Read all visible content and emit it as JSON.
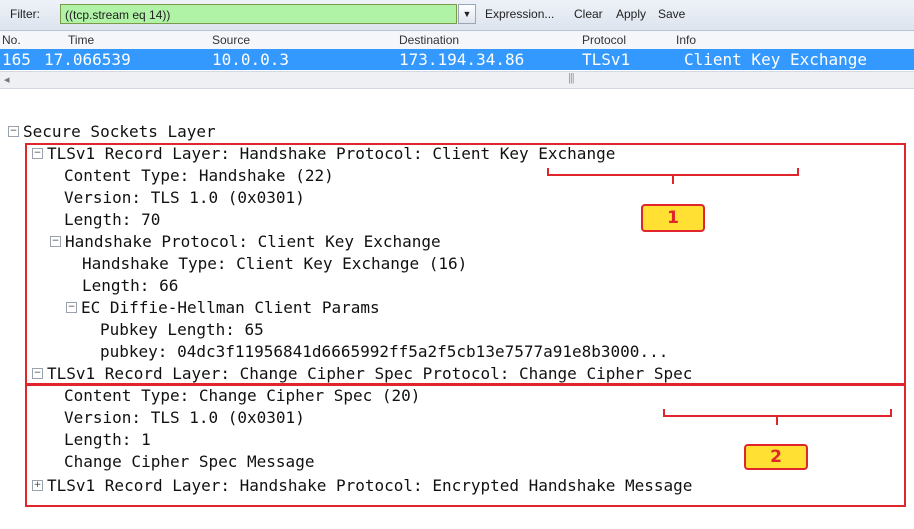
{
  "toolbar": {
    "filter_label": "Filter:",
    "filter_value": "((tcp.stream eq 14))",
    "expression": "Expression...",
    "clear": "Clear",
    "apply": "Apply",
    "save": "Save",
    "filter_color": "#b0f2a6"
  },
  "packet_list": {
    "columns": [
      "No.",
      "Time",
      "Source",
      "Destination",
      "Protocol",
      "Info"
    ],
    "selected_row": {
      "no": "165",
      "time": "17.066539",
      "source": "10.0.0.3",
      "destination": "173.194.34.86",
      "protocol": "TLSv1",
      "info": "Client Key Exchange"
    },
    "selection_color": "#3399ff"
  },
  "tree": {
    "ssl": "Secure Sockets Layer",
    "rec1": {
      "prefix": "TLSv1 Record Layer: Handshake Protocol: ",
      "highlight": "Client Key Exchange",
      "content_type": "Content Type: Handshake (22)",
      "version": "Version: TLS 1.0 (0x0301)",
      "length": "Length: 70",
      "hs": "Handshake Protocol: Client Key Exchange",
      "hs_type": "Handshake Type: Client Key Exchange (16)",
      "hs_length": "Length: 66",
      "ecdh": "EC Diffie-Hellman Client Params",
      "pubkey_len": "Pubkey Length: 65",
      "pubkey": "pubkey: 04dc3f11956841d6665992ff5a2f5cb13e7577a91e8b3000..."
    },
    "rec2": {
      "prefix": "TLSv1 Record Layer: Change Cipher Spec Protocol: ",
      "highlight": "Change Cipher Spec",
      "content_type": "Content Type: Change Cipher Spec (20)",
      "version": "Version: TLS 1.0 (0x0301)",
      "length": "Length: 1",
      "message": "Change Cipher Spec Message"
    },
    "rec3": "TLSv1 Record Layer: Handshake Protocol: Encrypted Handshake Message"
  },
  "annotations": {
    "badge1": "1",
    "badge2": "2",
    "accent": "#e0262c",
    "badge_fill": "#ffe033"
  }
}
